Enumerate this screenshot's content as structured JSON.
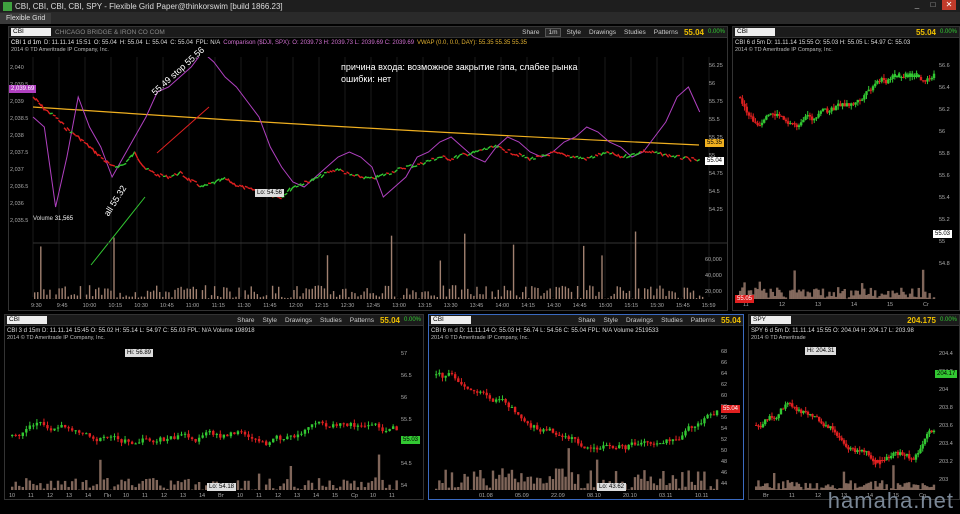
{
  "window": {
    "title": "CBI, CBI, CBI, CBI, SPY - Flexible Grid Paper@thinkorswim [build 1866.23]",
    "tab": "Flexible Grid",
    "minimize": "_",
    "maximize": "□",
    "close": "✕"
  },
  "toolbar": {
    "share": "Share",
    "style": "Style",
    "drawings": "Drawings",
    "studies": "Studies",
    "patterns": "Patterns"
  },
  "main": {
    "symbol": "CBI",
    "company": "CHICAGO BRIDGE & IRON CO COM",
    "price": "55.04",
    "pct": "0.00%",
    "info": [
      "CBI 1 d 1m",
      "D: 11.11.14 15:51",
      "O: 55.04",
      "H: 55.04",
      "L: 55.04",
      "C: 55.04",
      "FPL: N/A"
    ],
    "comparison": "Comparison ($DJI, SPX): O: 2039.73  H: 2039.73  L: 2039.69  C: 2039.69",
    "vwap": "VWAP (0.0, 0.0, DAY): 55.35  55.35  55.35",
    "copyright": "2014 © TD Ameritrade IP Company, Inc.",
    "annotation_line1": "причина входа: возможное закрытие гэпа, слабее рынка",
    "annotation_line2": "ошибки: нет",
    "stop_label": "55.49 stop 55.56",
    "entry_label": "all 55.32",
    "low_label": "Lo: 54.56",
    "volume_label": "Volume",
    "volume_value": "31,565",
    "left_price_tag": "2,039.69",
    "right_tag_vwap": "55.35",
    "right_tag_last": "55.04",
    "left_axis": [
      "2,040",
      "2,039.5",
      "2,039",
      "2,038.5",
      "2,038",
      "2,037.5",
      "2,037",
      "2,036.5",
      "2,036",
      "2,035.5"
    ],
    "right_axis": [
      "56.25",
      "56",
      "55.75",
      "55.5",
      "55.25",
      "55",
      "54.75",
      "54.5",
      "54.25"
    ],
    "vol_axis": [
      "60,000",
      "40,000",
      "20,000"
    ],
    "time_axis": [
      "9:30",
      "9:45",
      "10:00",
      "10:15",
      "10:30",
      "10:45",
      "11:00",
      "11:15",
      "11:30",
      "11:45",
      "12:00",
      "12:15",
      "12:30",
      "12:45",
      "13:00",
      "13:15",
      "13:30",
      "13:45",
      "14:00",
      "14:15",
      "14:30",
      "14:45",
      "15:00",
      "15:15",
      "15:30",
      "15:45",
      "15:59"
    ]
  },
  "topright": {
    "symbol": "CBI",
    "price": "55.04",
    "pct": "0.00%",
    "info": "CBI 6 d 5m  D: 11.11.14 15:55  O: 55.03  H: 55.05  L: 54.97  C: 55.03",
    "copyright": "2014 © TD Ameritrade IP Company, Inc.",
    "price_tag": "55.03",
    "price_tag2": "55.05",
    "axis": [
      "56.6",
      "56.4",
      "56.2",
      "56",
      "55.8",
      "55.6",
      "55.4",
      "55.2",
      "55",
      "54.8"
    ],
    "days": [
      "11",
      "12",
      "13",
      "14",
      "15",
      "Cr"
    ]
  },
  "bl": {
    "symbol": "CBI",
    "price": "55.04",
    "pct": "0.00%",
    "info": "CBI 3 d 15m  D: 11.11.14 15:45  O: 55.02  H: 55.14  L: 54.97  C: 55.03  FPL: N/A  Volume 198918",
    "copyright": "2014 © TD Ameritrade IP Company, Inc.",
    "high": "Hi: 56.89",
    "low": "Lo: 54.18",
    "tag": "55.03",
    "axis": [
      "57",
      "56.5",
      "56",
      "55.5",
      "55",
      "54.5",
      "54"
    ],
    "days": [
      "10",
      "11",
      "12",
      "13",
      "14",
      "Пн",
      "10",
      "11",
      "12",
      "13",
      "14",
      "Вт",
      "10",
      "11",
      "12",
      "13",
      "14",
      "15",
      "Ср",
      "10",
      "11"
    ]
  },
  "bm": {
    "symbol": "CBI",
    "price": "55.04",
    "pct": "0.00%",
    "info": "CBI 6 m d  D: 11.11.14  O: 55.03  H: 56.74  L: 54.56  C: 55.04  FPL: N/A  Volume 2519533",
    "copyright": "2014 © TD Ameritrade IP Company, Inc.",
    "low": "Lo: 43.62",
    "tag": "55.04",
    "axis": [
      "68",
      "66",
      "64",
      "62",
      "60",
      "58",
      "56",
      "54",
      "52",
      "50",
      "48",
      "46",
      "44"
    ],
    "months": [
      "01.08",
      "05.09",
      "22.09",
      "08.10",
      "20.10",
      "03.11",
      "10.11"
    ]
  },
  "br": {
    "symbol": "SPY",
    "price": "204.175",
    "pct": "0.00%",
    "info": "SPY 6 d 5m  D: 11.11.14 15:55  O: 204.04  H: 204.17  L: 203.98",
    "copyright": "2014 © TD Ameritrade",
    "high": "Hi: 204.31",
    "tag": "204.17",
    "axis": [
      "204.4",
      "204.2",
      "204",
      "203.8",
      "203.6",
      "203.4",
      "203.2",
      "203"
    ],
    "days": [
      "Вт",
      "11",
      "12",
      "13",
      "14",
      "15",
      "Ср"
    ]
  },
  "watermark": "hamaha.net",
  "colors": {
    "up": "#32c832",
    "down": "#e02020",
    "vwap": "#f0b020",
    "compare": "#b040c0",
    "volume": "#a08070",
    "accent_price": "#f0c000"
  }
}
